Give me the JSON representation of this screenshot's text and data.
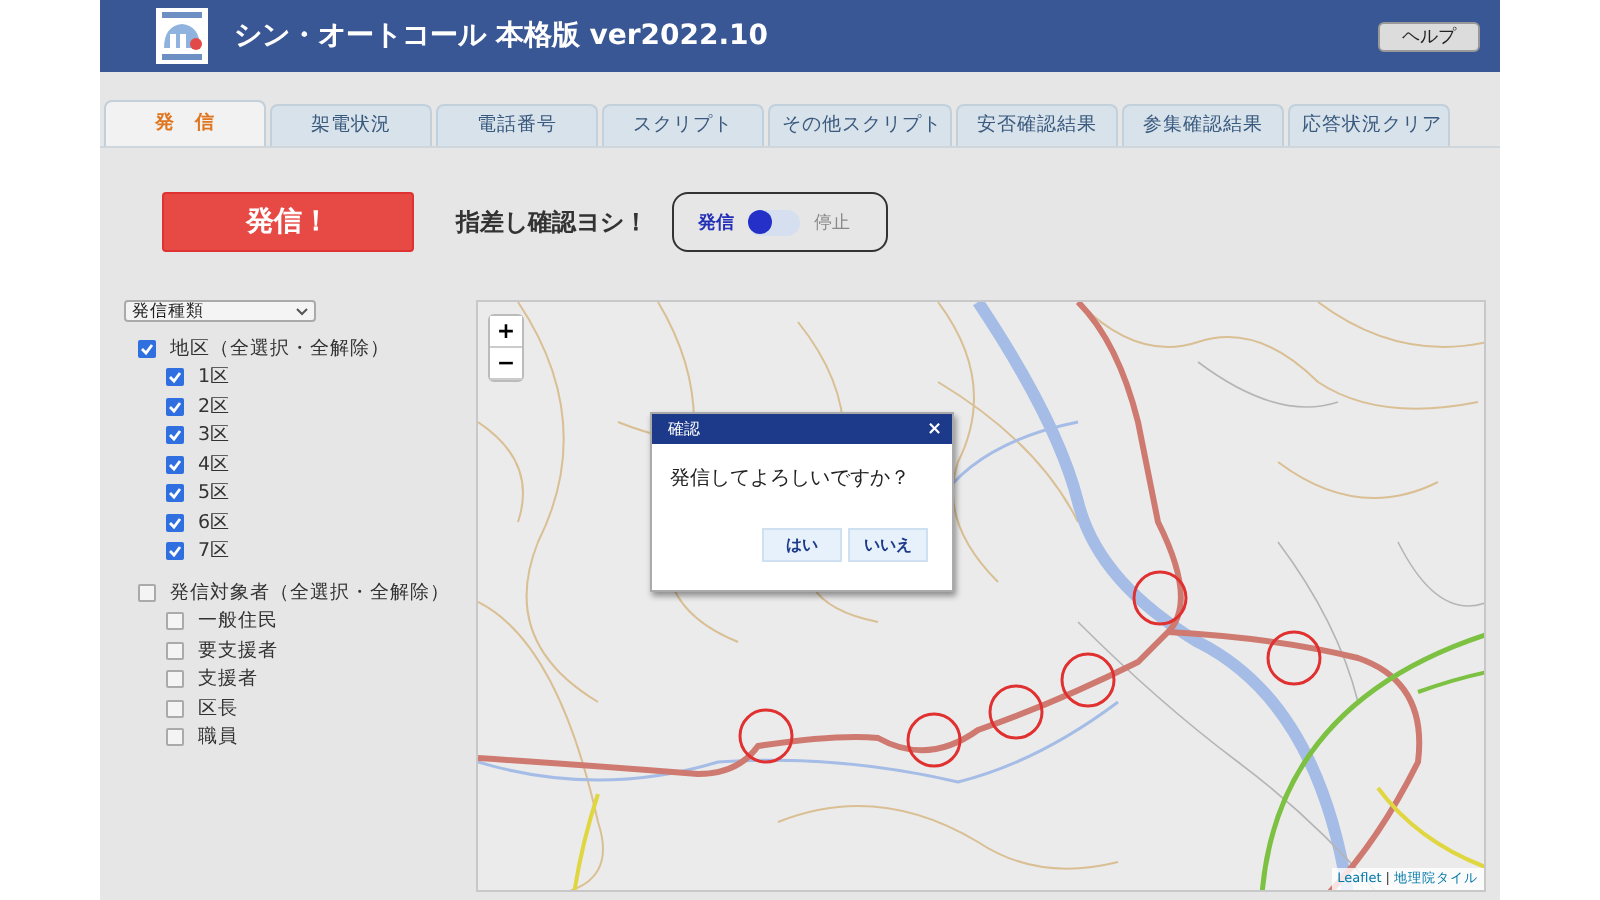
{
  "window": {
    "title": "シン・オートコール 本格版 ver2022.10"
  },
  "help_button": "ヘルプ",
  "tabs": [
    {
      "label": "発　信",
      "selected": true
    },
    {
      "label": "架電状況",
      "selected": false
    },
    {
      "label": "電話番号",
      "selected": false
    },
    {
      "label": "スクリプト",
      "selected": false
    },
    {
      "label": "その他スクリプト",
      "selected": false
    },
    {
      "label": "安否確認結果",
      "selected": false
    },
    {
      "label": "参集確認結果",
      "selected": false
    },
    {
      "label": "応答状況クリア",
      "selected": false
    }
  ],
  "send_button": "発信！",
  "confirm_label": "指差し確認ヨシ！",
  "toggle": {
    "options": [
      {
        "label": "発信",
        "selected": true
      },
      {
        "label": "停止",
        "selected": false
      }
    ]
  },
  "type_select": {
    "value": "発信種類"
  },
  "groups": [
    {
      "label": "地区（全選択・全解除）",
      "checked": true,
      "children": [
        {
          "label": "1区",
          "checked": true
        },
        {
          "label": "2区",
          "checked": true
        },
        {
          "label": "3区",
          "checked": true
        },
        {
          "label": "4区",
          "checked": true
        },
        {
          "label": "5区",
          "checked": true
        },
        {
          "label": "6区",
          "checked": true
        },
        {
          "label": "7区",
          "checked": true
        }
      ]
    },
    {
      "label": "発信対象者（全選択・全解除）",
      "checked": false,
      "children": [
        {
          "label": "一般住民",
          "checked": false
        },
        {
          "label": "要支援者",
          "checked": false
        },
        {
          "label": "支援者",
          "checked": false
        },
        {
          "label": "区長",
          "checked": false
        },
        {
          "label": "職員",
          "checked": false
        }
      ]
    }
  ],
  "map": {
    "zoom_in": "+",
    "zoom_out": "−",
    "attribution_link": "Leaflet",
    "attribution_separator": "|",
    "attribution_source": "地理院タイル"
  },
  "dialog": {
    "title": "確認",
    "close": "×",
    "message": "発信してよろしいですか？",
    "buttons": [
      "はい",
      "いいえ"
    ]
  }
}
